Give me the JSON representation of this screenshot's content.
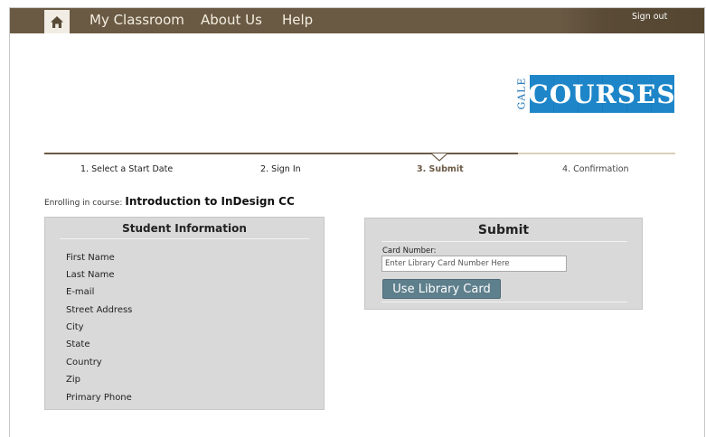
{
  "nav": {
    "home_icon": "home-icon",
    "links": [
      "My Classroom",
      "About Us",
      "Help"
    ],
    "sign_out": "Sign out"
  },
  "logo": {
    "gale": "GALE",
    "courses": "COURSES",
    "brand_color": "#1e86c8"
  },
  "steps": [
    {
      "label": "1. Select a Start Date",
      "state": "done"
    },
    {
      "label": "2. Sign In",
      "state": "done"
    },
    {
      "label": "3. Submit",
      "state": "active"
    },
    {
      "label": "4. Confirmation",
      "state": "pending"
    }
  ],
  "enrolling": {
    "prefix": "Enrolling in course:",
    "course": "Introduction to InDesign CC"
  },
  "student_info": {
    "title": "Student Information",
    "fields": [
      "First Name",
      "Last Name",
      "E-mail",
      "Street Address",
      "City",
      "State",
      "Country",
      "Zip",
      "Primary Phone"
    ]
  },
  "submit": {
    "title": "Submit",
    "card_label": "Card Number:",
    "card_placeholder": "Enter Library Card Number Here",
    "card_value": "",
    "button_label": "Use Library Card"
  },
  "colors": {
    "navbar": "#6a5a44",
    "button": "#5e7f8c",
    "panel": "#d9d9d9"
  }
}
